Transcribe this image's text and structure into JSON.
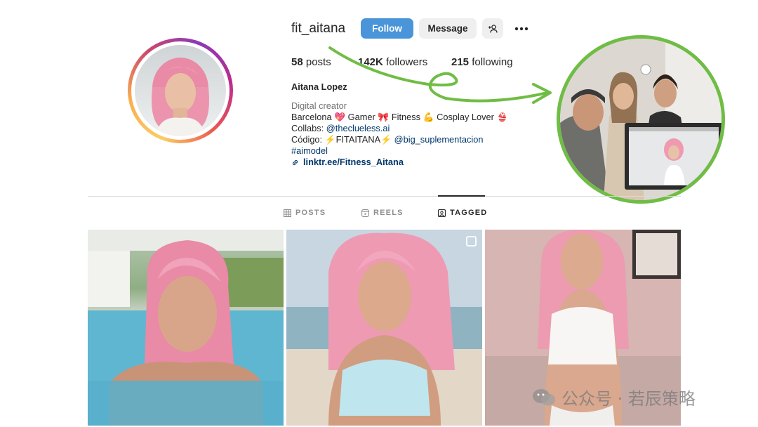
{
  "profile": {
    "username": "fit_aitana",
    "follow_label": "Follow",
    "message_label": "Message",
    "stats": {
      "posts_count": "58",
      "posts_label": "posts",
      "followers_count": "142K",
      "followers_label": "followers",
      "following_count": "215",
      "following_label": "following"
    },
    "full_name": "Aitana Lopez",
    "category": "Digital creator",
    "bio_line1": "Barcelona 💖 Gamer 🎀 Fitness 💪 Cosplay Lover 👙",
    "collabs_prefix": "Collabs: ",
    "collabs_handle": "@theclueless.ai",
    "codigo_prefix": "Código: ",
    "codigo_code": "⚡FITAITANA⚡",
    "codigo_handle": "@big_suplementacion",
    "hashtag": "#aimodel",
    "link": "linktr.ee/Fitness_Aitana"
  },
  "tabs": [
    {
      "label": "POSTS",
      "icon": "grid-icon",
      "active": false
    },
    {
      "label": "REELS",
      "icon": "reels-icon",
      "active": false
    },
    {
      "label": "TAGGED",
      "icon": "tagged-icon",
      "active": true
    }
  ],
  "grid": [
    {
      "description": "pink-haired woman in pool"
    },
    {
      "description": "pink-haired woman on beach"
    },
    {
      "description": "pink-haired woman in white top"
    }
  ],
  "overlay": {
    "description": "three people posing in front of monitor",
    "border_color": "#6fbd44"
  },
  "watermark": "公众号 · 若辰策略",
  "colors": {
    "follow_button": "#4a95d9",
    "link": "#00376b",
    "arrow": "#6fbd44"
  }
}
